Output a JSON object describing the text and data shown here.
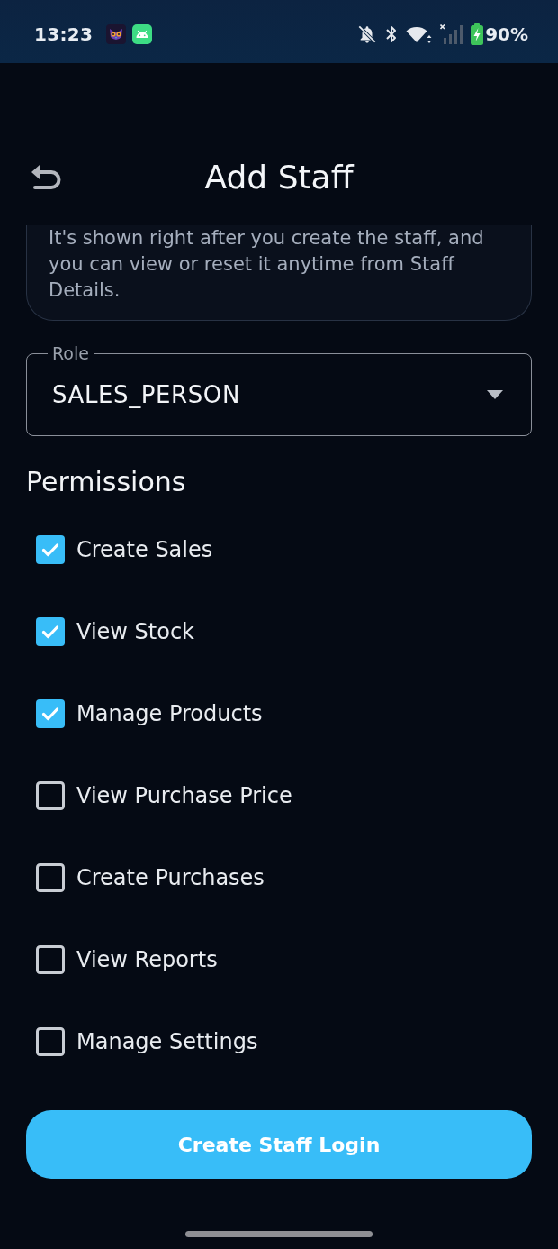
{
  "status_bar": {
    "time": "13:23",
    "battery": "90%"
  },
  "header": {
    "title": "Add Staff"
  },
  "info_card": {
    "text": "It's shown right after you create the staff, and you can view or reset it anytime from Staff Details."
  },
  "role_field": {
    "label": "Role",
    "value": "SALES_PERSON"
  },
  "permissions": {
    "heading": "Permissions",
    "items": [
      {
        "label": "Create Sales",
        "checked": true
      },
      {
        "label": "View Stock",
        "checked": true
      },
      {
        "label": "Manage Products",
        "checked": true
      },
      {
        "label": "View Purchase Price",
        "checked": false
      },
      {
        "label": "Create Purchases",
        "checked": false
      },
      {
        "label": "View Reports",
        "checked": false
      },
      {
        "label": "Manage Settings",
        "checked": false
      }
    ]
  },
  "submit_button": {
    "label": "Create Staff Login"
  }
}
